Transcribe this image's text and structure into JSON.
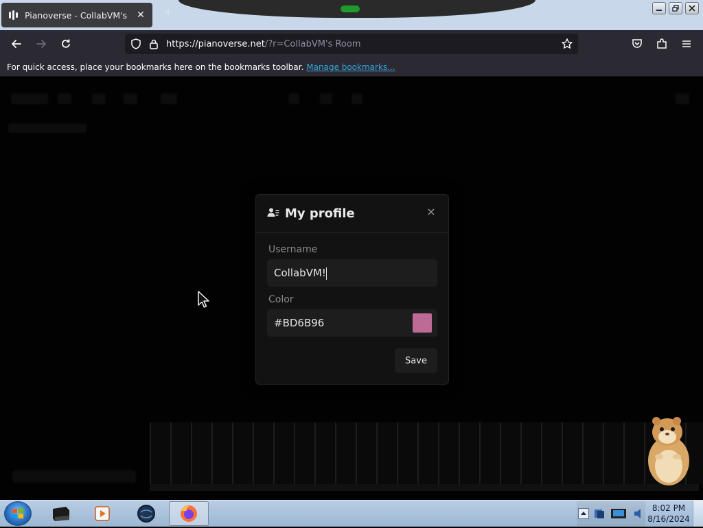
{
  "browser": {
    "tab_title": "Pianoverse - CollabVM's Room",
    "tab_close": "✕",
    "new_tab": "+",
    "url_host": "https://pianoverse.net",
    "url_path": "/?r=CollabVM's Room",
    "bookmarks_text": "For quick access, place your bookmarks here on the bookmarks toolbar.",
    "bookmarks_link": "Manage bookmarks..."
  },
  "modal": {
    "title": "My profile",
    "close": "×",
    "username_label": "Username",
    "username_value": "CollabVM!",
    "color_label": "Color",
    "color_value": "#BD6B96",
    "color_swatch": "#BD6B96",
    "save_label": "Save"
  },
  "taskbar": {
    "time": "8:02 PM",
    "date": "8/16/2024"
  },
  "colors": {
    "accent_link": "#35a5d8",
    "page_bg": "#020202"
  }
}
